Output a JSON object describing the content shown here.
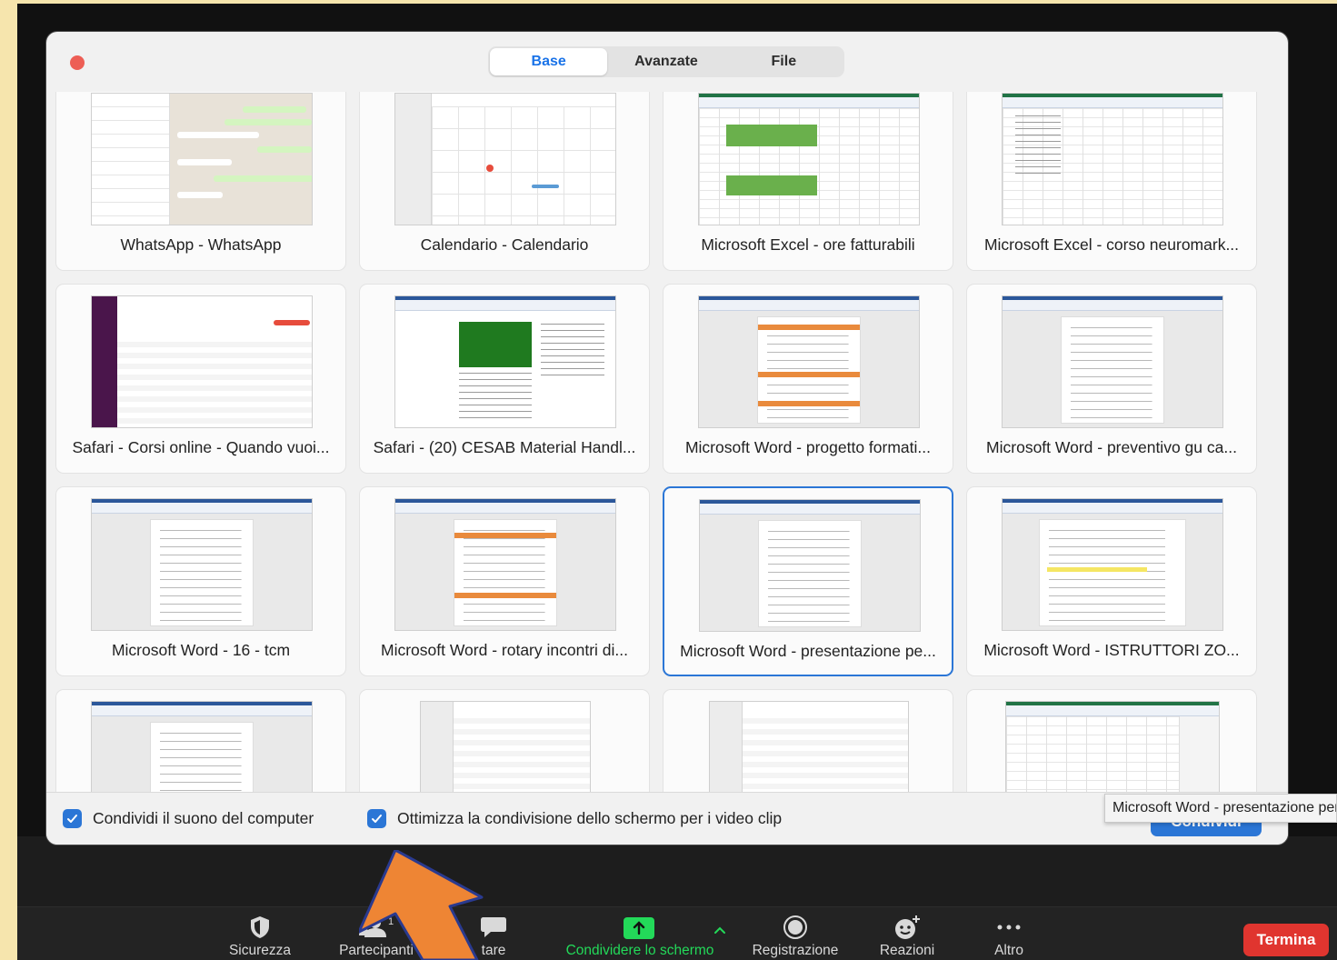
{
  "dialog": {
    "tabs": [
      {
        "label": "Base",
        "active": true
      },
      {
        "label": "Avanzate",
        "active": false
      },
      {
        "label": "File",
        "active": false
      }
    ],
    "windows": [
      {
        "label": "WhatsApp - WhatsApp",
        "kind": "whatsapp"
      },
      {
        "label": "Calendario - Calendario",
        "kind": "calendar"
      },
      {
        "label": "Microsoft Excel - ore fatturabili",
        "kind": "excel-green"
      },
      {
        "label": "Microsoft Excel - corso neuromark...",
        "kind": "excel"
      },
      {
        "label": "Safari - Corsi online - Quando vuoi...",
        "kind": "safari-list"
      },
      {
        "label": "Safari - (20) CESAB Material Handl...",
        "kind": "safari-social"
      },
      {
        "label": "Microsoft Word - progetto formati...",
        "kind": "word-orange"
      },
      {
        "label": "Microsoft Word - preventivo gu ca...",
        "kind": "word"
      },
      {
        "label": "Microsoft Word - 16 - tcm",
        "kind": "word"
      },
      {
        "label": "Microsoft Word - rotary incontri di...",
        "kind": "word-orange"
      },
      {
        "label": "Microsoft Word - presentazione pe...",
        "kind": "word",
        "selected": true
      },
      {
        "label": "Microsoft Word - ISTRUTTORI ZO...",
        "kind": "word-highlight"
      },
      {
        "label": "",
        "kind": "word"
      },
      {
        "label": "",
        "kind": "finder"
      },
      {
        "label": "",
        "kind": "finder"
      },
      {
        "label": "",
        "kind": "excel-green"
      }
    ],
    "footer": {
      "share_sound": "Condividi il suono del computer",
      "optimize_video": "Ottimizza la condivisione dello schermo per i video clip",
      "share_button": "Condividi"
    },
    "tooltip": "Microsoft Word - presentazione per"
  },
  "toolbar": {
    "items": [
      {
        "label": "Sicurezza",
        "icon": "shield-icon"
      },
      {
        "label": "Partecipanti",
        "icon": "participants-icon",
        "count": "1"
      },
      {
        "label": "tare",
        "icon": "chat-icon"
      },
      {
        "label": "Condividere lo schermo",
        "icon": "share-screen-icon"
      },
      {
        "label": "Registrazione",
        "icon": "record-icon"
      },
      {
        "label": "Reazioni",
        "icon": "reactions-icon"
      },
      {
        "label": "Altro",
        "icon": "more-icon"
      }
    ],
    "end_button": "Termina"
  },
  "colors": {
    "accent": "#2b76d6",
    "share_green": "#23d959",
    "end_red": "#e0352f",
    "annotation_arrow": "#ee8534"
  }
}
